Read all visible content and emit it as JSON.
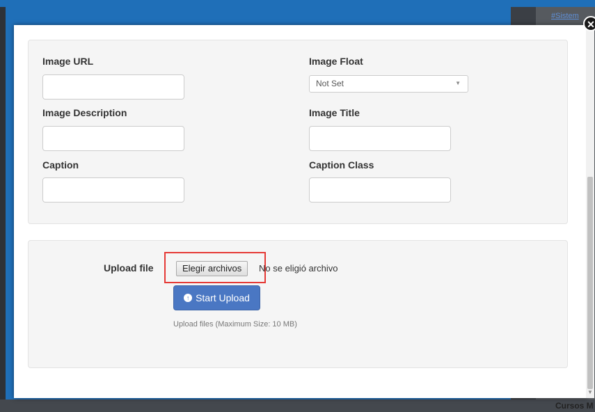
{
  "background": {
    "right_link": "#Sistem",
    "footer_text": "Cursos M"
  },
  "modal": {
    "close_symbol": "✕",
    "fields": {
      "image_url": {
        "label": "Image URL",
        "value": ""
      },
      "image_float": {
        "label": "Image Float",
        "selected": "Not Set"
      },
      "image_description": {
        "label": "Image Description",
        "value": ""
      },
      "image_title": {
        "label": "Image Title",
        "value": ""
      },
      "caption": {
        "label": "Caption",
        "value": ""
      },
      "caption_class": {
        "label": "Caption Class",
        "value": ""
      }
    },
    "upload": {
      "label": "Upload file",
      "choose_button": "Elegir archivos",
      "file_status": "No se eligió archivo",
      "start_button": "Start Upload",
      "start_icon": "upload-circle-icon",
      "help_text": "Upload files (Maximum Size: 10 MB)"
    }
  },
  "colors": {
    "accent_button": "#4a77c3",
    "highlight_box": "#e53935"
  }
}
